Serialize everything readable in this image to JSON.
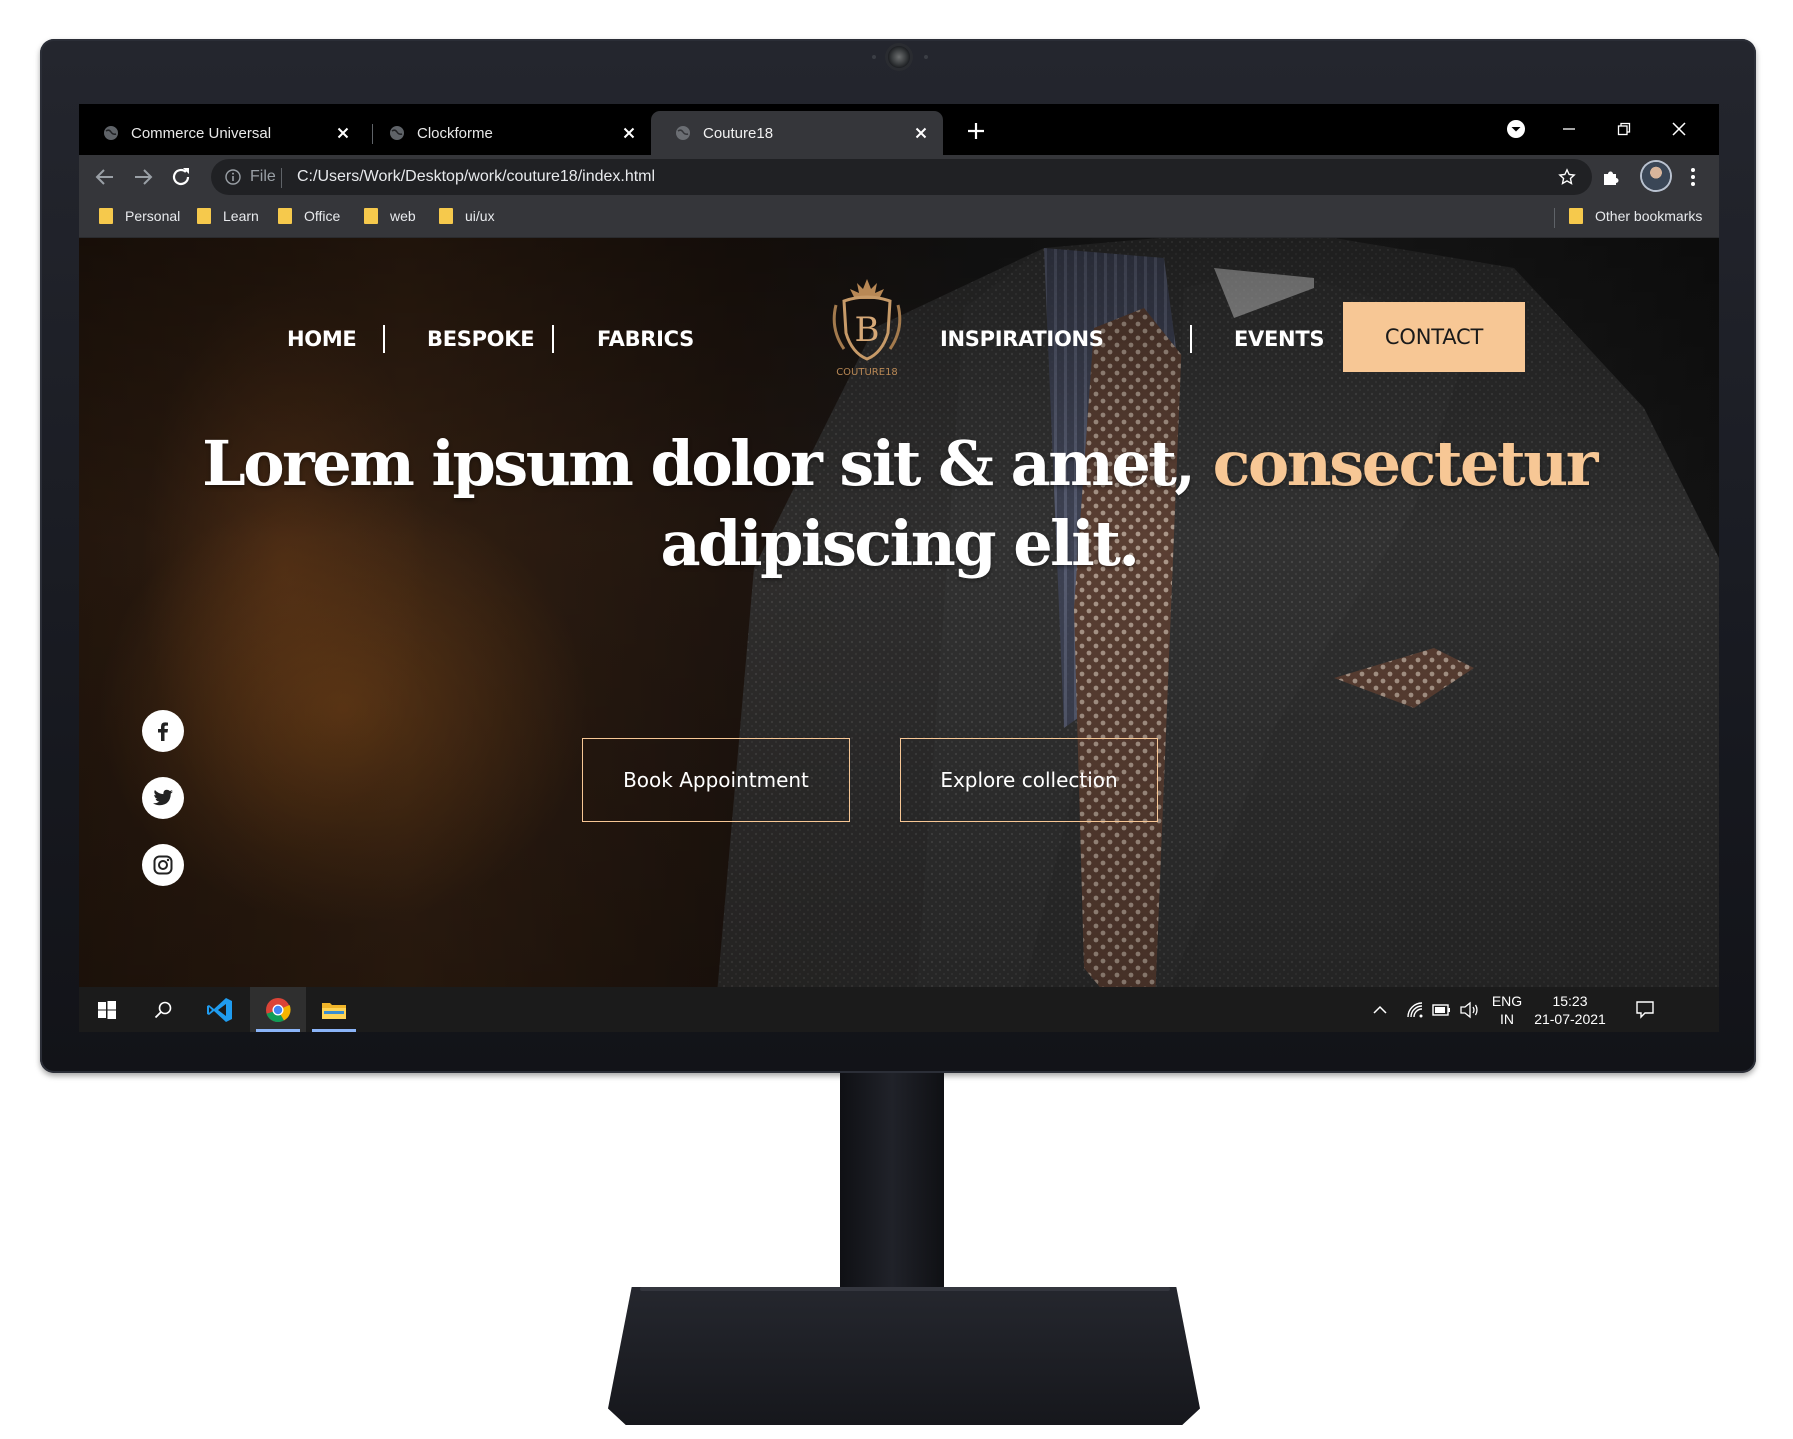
{
  "browser": {
    "tabs": [
      {
        "title": "Commerce Universal",
        "active": false
      },
      {
        "title": "Clockforme",
        "active": false
      },
      {
        "title": "Couture18",
        "active": true
      }
    ],
    "omnibox": {
      "scheme_label": "File",
      "url": "C:/Users/Work/Desktop/work/couture18/index.html"
    },
    "bookmarks": [
      "Personal",
      "Learn",
      "Office",
      "web",
      "ui/ux"
    ],
    "other_bookmarks": "Other bookmarks"
  },
  "site": {
    "nav_left": [
      "HOME",
      "BESPOKE",
      "FABRICS"
    ],
    "nav_right": [
      "INSPIRATIONS",
      "EVENTS"
    ],
    "contact_label": "CONTACT",
    "logo_text": "COUTURE18",
    "hero": {
      "line1": "Lorem ipsum dolor sit & amet, ",
      "accent": "consectetur",
      "line2": "adipiscing elit."
    },
    "buttons": {
      "book": "Book Appointment",
      "explore": "Explore collection"
    },
    "social": [
      "facebook-icon",
      "twitter-icon",
      "instagram-icon"
    ],
    "colors": {
      "accent": "#f7c795"
    }
  },
  "taskbar": {
    "language": "ENG",
    "region": "IN",
    "time": "15:23",
    "date": "21-07-2021"
  }
}
